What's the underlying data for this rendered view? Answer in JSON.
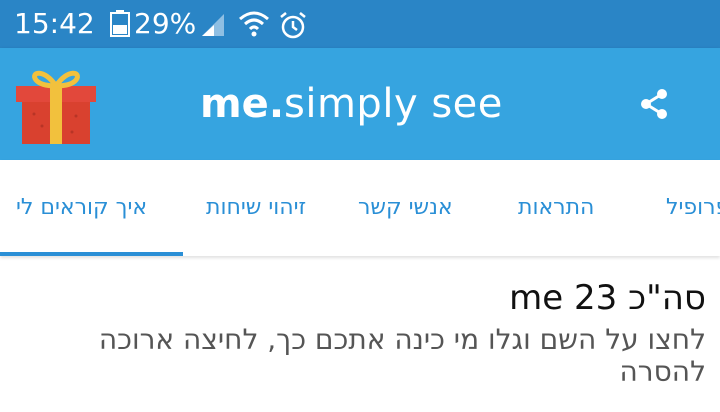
{
  "status_bar": {
    "time": "15:42",
    "battery_percent": "29%",
    "icons": [
      "battery-icon",
      "cell-signal-icon",
      "wifi-icon",
      "alarm-icon"
    ]
  },
  "app_bar": {
    "logo_bold": "me",
    "logo_dot": ".",
    "logo_rest": "simply see",
    "icons": [
      "gift-icon",
      "share-icon"
    ]
  },
  "tabs": [
    {
      "label": "איך קוראים לי",
      "active": true
    },
    {
      "label": "זיהוי שיחות",
      "active": false
    },
    {
      "label": "אנשי קשר",
      "active": false
    },
    {
      "label": "התראות",
      "active": false
    },
    {
      "label": "פרופיל",
      "active": false
    }
  ],
  "content": {
    "count_title": "סה\"כ 23 me",
    "instruction": "לחצו על השם וגלו מי כינה אתכם כך, לחיצה ארוכה להסרה"
  },
  "colors": {
    "status_bar": "#2a85c6",
    "app_bar": "#36a4e0",
    "tab_text": "#2a8fd6",
    "gift_red": "#e2483b",
    "gift_ribbon": "#f2c13d"
  }
}
